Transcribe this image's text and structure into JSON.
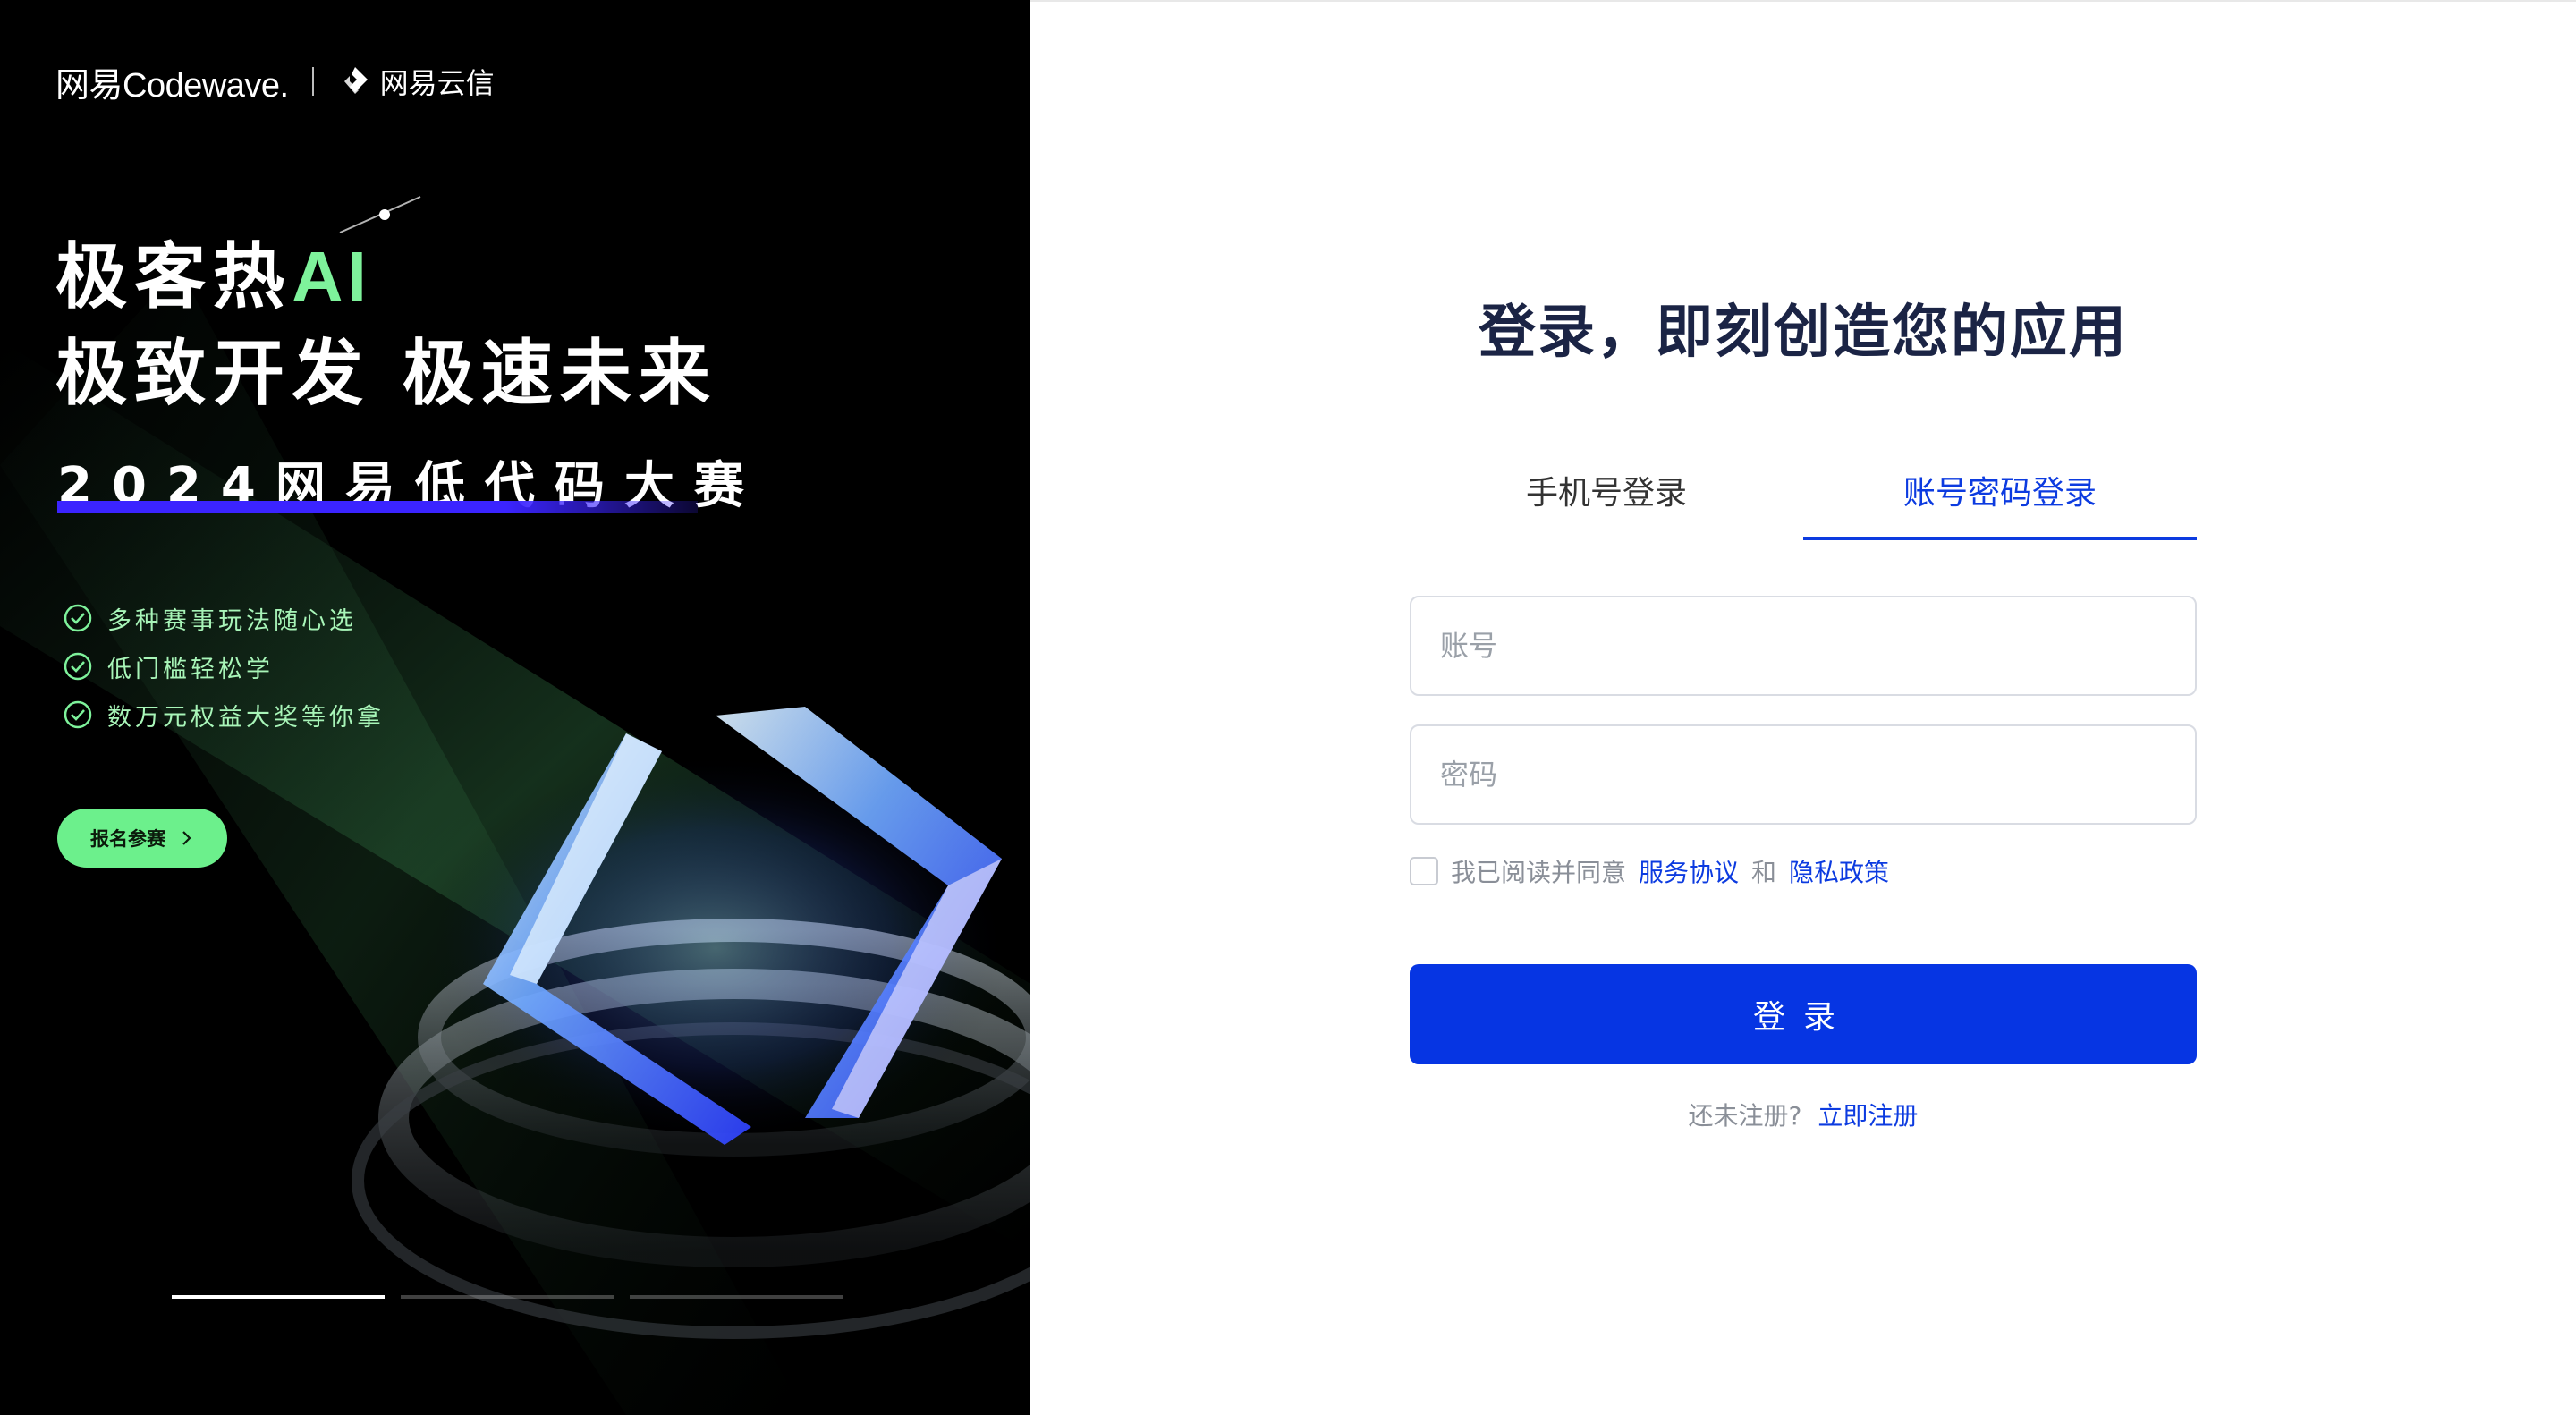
{
  "brand": {
    "codewave": "网易Codewave.",
    "yunxin": "网易云信"
  },
  "promo": {
    "headline_line1_prefix": "极客热",
    "headline_line1_ai": "AI",
    "headline_line2": "极致开发 极速未来",
    "contest_title": "2024网易低代码大赛",
    "features": [
      "多种赛事玩法随心选",
      "低门槛轻松学",
      "数万元权益大奖等你拿"
    ],
    "join_button": "报名参赛",
    "carousel_active_index": 0,
    "carousel_count": 3,
    "accent_color": "#6cf08c",
    "bar_color": "#3b24ff"
  },
  "login": {
    "title": "登录，即刻创造您的应用",
    "tabs": [
      {
        "label": "手机号登录",
        "active": false
      },
      {
        "label": "账号密码登录",
        "active": true
      }
    ],
    "account_placeholder": "账号",
    "password_placeholder": "密码",
    "agree_text": "我已阅读并同意",
    "service_link": "服务协议",
    "and_text": "和",
    "privacy_link": "隐私政策",
    "submit_label": "登录",
    "register_prompt": "还未注册?",
    "register_link": "立即注册",
    "primary_color": "#0635e3"
  }
}
